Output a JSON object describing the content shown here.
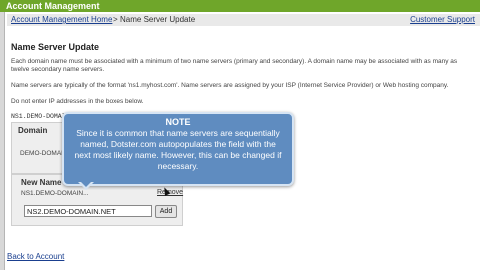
{
  "window": {
    "title": "Account Management"
  },
  "breadcrumb": {
    "home": "Account Management Home",
    "separator": ">",
    "current": "Name Server Update"
  },
  "header": {
    "support_link": "Customer Support"
  },
  "page": {
    "heading": "Name Server Update",
    "para1": "Each domain name must be associated with a minimum of two name servers (primary and secondary). A domain name may be associated with as many as twelve secondary name servers.",
    "para2": "Name servers are typically of the format 'ns1.myhost.com'. Name servers are assigned by your ISP (Internet Service Provider) or Web hosting company.",
    "para3": "Do not enter IP addresses in the boxes below.",
    "ns_row": "NS1.DEMO-DOMAIN..."
  },
  "domain_box": {
    "label": "Domain",
    "value": "DEMO-DOMAIN..."
  },
  "new_name": {
    "label": "New Name",
    "ns1": "NS1.DEMO-DOMAIN...",
    "remove_label": "Remove",
    "ns2_value": "NS2.DEMO-DOMAIN.NET",
    "add_label": "Add"
  },
  "tooltip": {
    "title": "NOTE",
    "body": "Since it is common that name servers are sequentially named, Dotster.com autopopulates the field with the next most likely name.  However, this can be changed if necessary."
  },
  "footer": {
    "back_link": "Back to Account"
  },
  "colors": {
    "titlebar": "#6fa62a",
    "tooltip": "#5f8cc0",
    "link": "#1a3f8f"
  }
}
